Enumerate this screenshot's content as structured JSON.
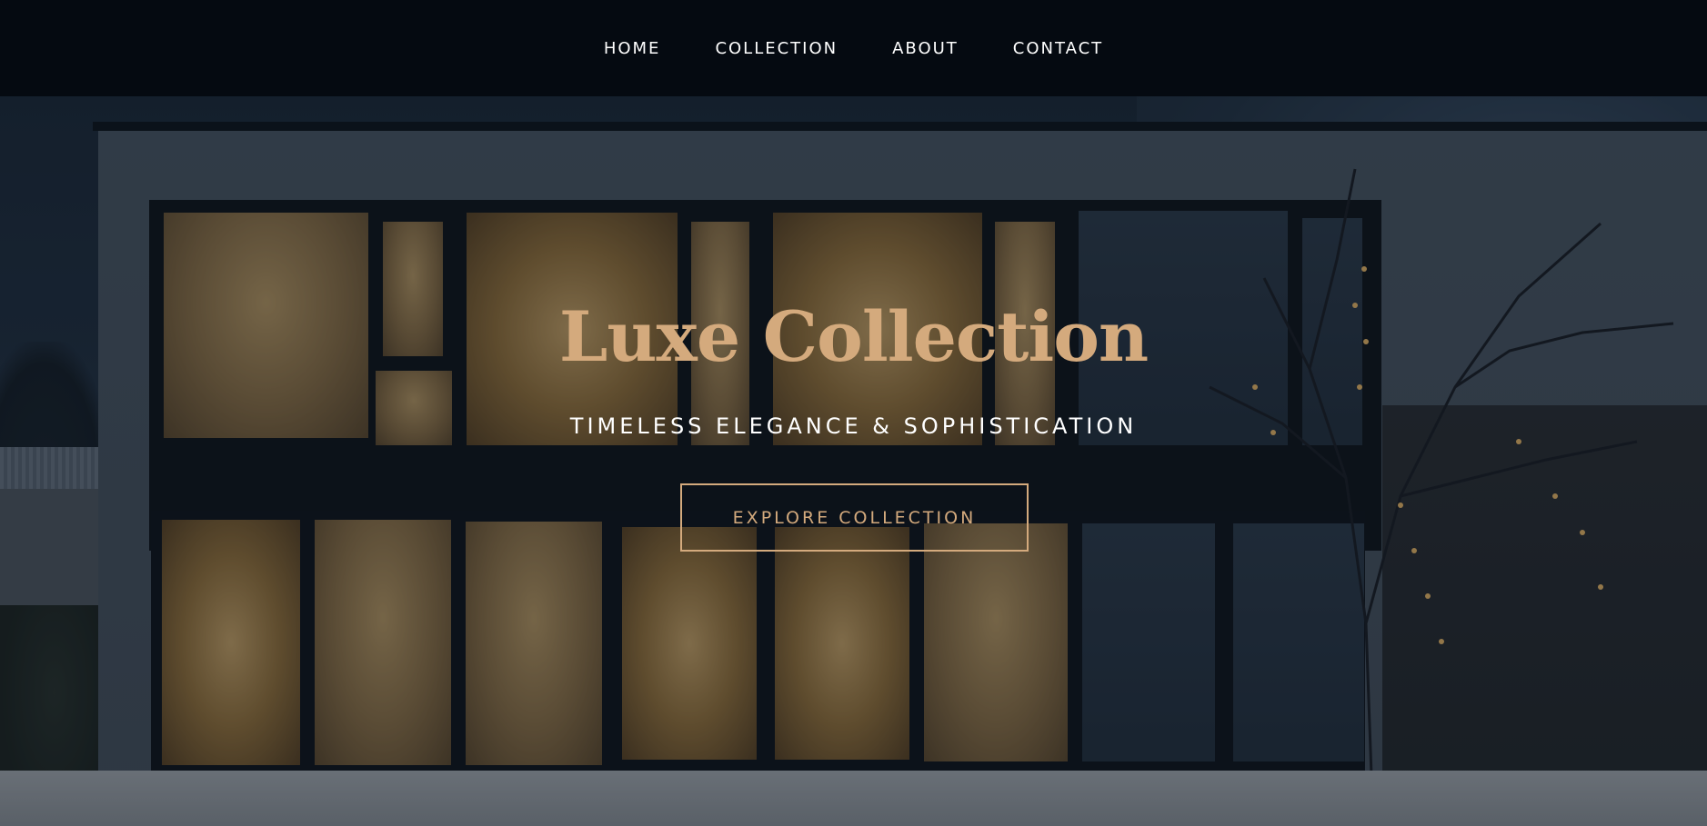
{
  "nav": {
    "items": [
      {
        "label": "HOME"
      },
      {
        "label": "COLLECTION"
      },
      {
        "label": "ABOUT"
      },
      {
        "label": "CONTACT"
      }
    ]
  },
  "hero": {
    "title": "Luxe Collection",
    "subtitle": "TIMELESS ELEGANCE & SOPHISTICATION",
    "cta_label": "EXPLORE COLLECTION"
  },
  "colors": {
    "nav_bg": "#050a11",
    "accent": "#d4aa7d",
    "text_light": "#ffffff"
  }
}
